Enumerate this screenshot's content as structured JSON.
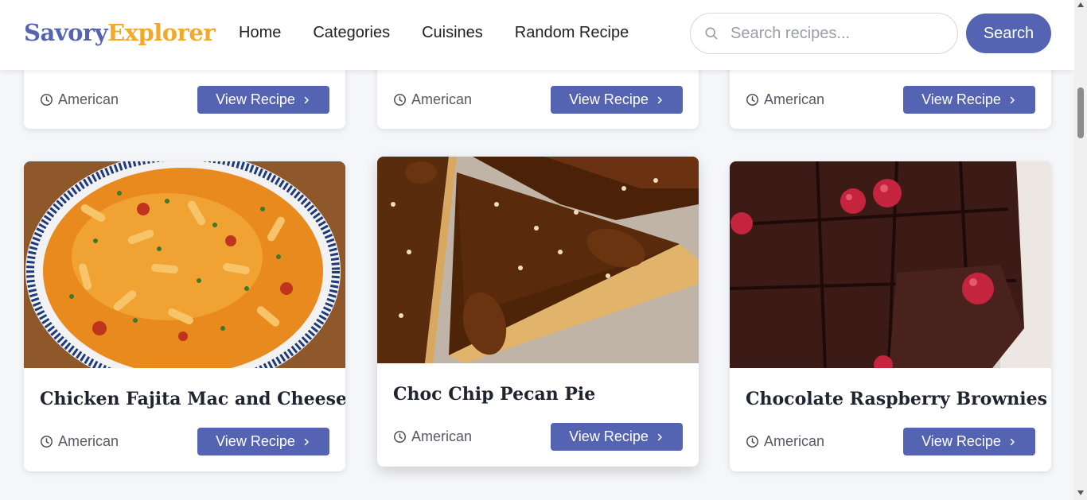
{
  "header": {
    "logo_part1": "Savory",
    "logo_part2": "Explorer",
    "nav": [
      "Home",
      "Categories",
      "Cuisines",
      "Random Recipe"
    ],
    "search_placeholder": "Search recipes...",
    "search_button": "Search"
  },
  "top_row": [
    {
      "cuisine": "American",
      "button": "View Recipe"
    },
    {
      "cuisine": "American",
      "button": "View Recipe"
    },
    {
      "cuisine": "American",
      "button": "View Recipe"
    }
  ],
  "cards": [
    {
      "title": "Chicken Fajita Mac and Cheese",
      "cuisine": "American",
      "button": "View Recipe"
    },
    {
      "title": "Choc Chip Pecan Pie",
      "cuisine": "American",
      "button": "View Recipe"
    },
    {
      "title": "Chocolate Raspberry Brownies",
      "cuisine": "American",
      "button": "View Recipe"
    }
  ],
  "colors": {
    "brand_primary": "#5563b3",
    "brand_accent": "#f4a82a",
    "background": "#f5f6fa"
  },
  "icons": {
    "search": "search-icon",
    "clock": "clock-icon",
    "chevron": "chevron-right-icon"
  }
}
